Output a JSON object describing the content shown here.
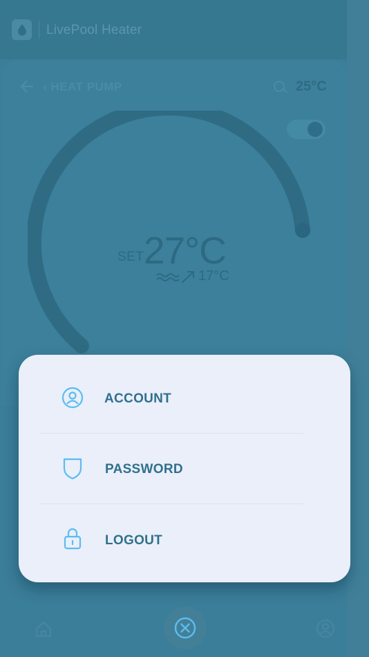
{
  "app": {
    "title": "LivePool Heater"
  },
  "header": {
    "breadcrumb": "‹ HEAT PUMP",
    "ambient_temperature": "25°C"
  },
  "controls": {
    "power_toggle_on": true
  },
  "dial": {
    "set_label": "SET",
    "set_temperature": "27°C",
    "water_temperature": "17°C"
  },
  "menu": {
    "items": [
      {
        "label": "ACCOUNT",
        "icon": "user-circle-icon"
      },
      {
        "label": "PASSWORD",
        "icon": "shield-icon"
      },
      {
        "label": "LOGOUT",
        "icon": "lock-icon"
      }
    ]
  },
  "bottom_nav": {
    "items": [
      {
        "icon": "home-icon"
      },
      {
        "icon": "close-circle-icon"
      },
      {
        "icon": "profile-icon"
      }
    ]
  },
  "colors": {
    "overlay_background": "#3b7e99",
    "menu_background": "#eaeff9",
    "menu_text": "#30708c",
    "menu_icon": "#5bbcf0"
  }
}
